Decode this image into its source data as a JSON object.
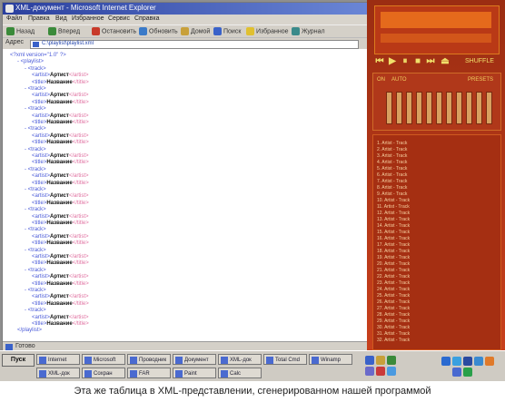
{
  "ie": {
    "title": "XML-документ - Microsoft Internet Explorer",
    "menu": [
      "Файл",
      "Правка",
      "Вид",
      "Избранное",
      "Сервис",
      "Справка"
    ],
    "toolbar": [
      "Назад",
      "Вперед",
      "Остановить",
      "Обновить",
      "Домой",
      "Поиск",
      "Избранное",
      "Журнал"
    ],
    "address_label": "Адрес",
    "address_value": "C:\\playlist\\playlist.xml",
    "status": "Готово"
  },
  "xml_lines": [
    {
      "indent": 0,
      "text": "<?xml version=\"1.0\" ?>",
      "kind": "tag"
    },
    {
      "indent": 1,
      "text": "- <playlist>",
      "kind": "tag"
    },
    {
      "indent": 2,
      "text": "- <track>",
      "kind": "tag"
    },
    {
      "indent": 3,
      "text": "<artist>",
      "kind": "tag",
      "value": "Артист",
      "end": "</artist>"
    },
    {
      "indent": 3,
      "text": "<title>",
      "kind": "tag",
      "value": "Название",
      "end": "</title>"
    },
    {
      "indent": 2,
      "text": "- <track>",
      "kind": "tag"
    },
    {
      "indent": 3,
      "text": "<artist>",
      "kind": "tag",
      "value": "Артист",
      "end": "</artist>"
    },
    {
      "indent": 3,
      "text": "<title>",
      "kind": "tag",
      "value": "Название",
      "end": "</title>"
    },
    {
      "indent": 2,
      "text": "- <track>",
      "kind": "tag"
    },
    {
      "indent": 3,
      "text": "<artist>",
      "kind": "tag",
      "value": "Артист",
      "end": "</artist>"
    },
    {
      "indent": 3,
      "text": "<title>",
      "kind": "tag",
      "value": "Название",
      "end": "</title>"
    },
    {
      "indent": 2,
      "text": "- <track>",
      "kind": "tag"
    },
    {
      "indent": 3,
      "text": "<artist>",
      "kind": "tag",
      "value": "Артист",
      "end": "</artist>"
    },
    {
      "indent": 3,
      "text": "<title>",
      "kind": "tag",
      "value": "Название",
      "end": "</title>"
    },
    {
      "indent": 2,
      "text": "- <track>",
      "kind": "tag"
    },
    {
      "indent": 3,
      "text": "<artist>",
      "kind": "tag",
      "value": "Артист",
      "end": "</artist>"
    },
    {
      "indent": 3,
      "text": "<title>",
      "kind": "tag",
      "value": "Название",
      "end": "</title>"
    },
    {
      "indent": 2,
      "text": "- <track>",
      "kind": "tag"
    },
    {
      "indent": 3,
      "text": "<artist>",
      "kind": "tag",
      "value": "Артист",
      "end": "</artist>"
    },
    {
      "indent": 3,
      "text": "<title>",
      "kind": "tag",
      "value": "Название",
      "end": "</title>"
    },
    {
      "indent": 2,
      "text": "- <track>",
      "kind": "tag"
    },
    {
      "indent": 3,
      "text": "<artist>",
      "kind": "tag",
      "value": "Артист",
      "end": "</artist>"
    },
    {
      "indent": 3,
      "text": "<title>",
      "kind": "tag",
      "value": "Название",
      "end": "</title>"
    },
    {
      "indent": 2,
      "text": "- <track>",
      "kind": "tag"
    },
    {
      "indent": 3,
      "text": "<artist>",
      "kind": "tag",
      "value": "Артист",
      "end": "</artist>"
    },
    {
      "indent": 3,
      "text": "<title>",
      "kind": "tag",
      "value": "Название",
      "end": "</title>"
    },
    {
      "indent": 2,
      "text": "- <track>",
      "kind": "tag"
    },
    {
      "indent": 3,
      "text": "<artist>",
      "kind": "tag",
      "value": "Артист",
      "end": "</artist>"
    },
    {
      "indent": 3,
      "text": "<title>",
      "kind": "tag",
      "value": "Название",
      "end": "</title>"
    },
    {
      "indent": 2,
      "text": "- <track>",
      "kind": "tag"
    },
    {
      "indent": 3,
      "text": "<artist>",
      "kind": "tag",
      "value": "Артист",
      "end": "</artist>"
    },
    {
      "indent": 3,
      "text": "<title>",
      "kind": "tag",
      "value": "Название",
      "end": "</title>"
    },
    {
      "indent": 2,
      "text": "- <track>",
      "kind": "tag"
    },
    {
      "indent": 3,
      "text": "<artist>",
      "kind": "tag",
      "value": "Артист",
      "end": "</artist>"
    },
    {
      "indent": 3,
      "text": "<title>",
      "kind": "tag",
      "value": "Название",
      "end": "</title>"
    },
    {
      "indent": 2,
      "text": "- <track>",
      "kind": "tag"
    },
    {
      "indent": 3,
      "text": "<artist>",
      "kind": "tag",
      "value": "Артист",
      "end": "</artist>"
    },
    {
      "indent": 3,
      "text": "<title>",
      "kind": "tag",
      "value": "Название",
      "end": "</title>"
    },
    {
      "indent": 2,
      "text": "- <track>",
      "kind": "tag"
    },
    {
      "indent": 3,
      "text": "<artist>",
      "kind": "tag",
      "value": "Артист",
      "end": "</artist>"
    },
    {
      "indent": 3,
      "text": "<title>",
      "kind": "tag",
      "value": "Название",
      "end": "</title>"
    },
    {
      "indent": 1,
      "text": "</playlist>",
      "kind": "tag"
    }
  ],
  "winamp": {
    "mode_label": "SHUFFLE",
    "eq_labels": [
      "ON",
      "AUTO",
      "PRESETS"
    ],
    "playlist": [
      "1. Artist - Track",
      "2. Artist - Track",
      "3. Artist - Track",
      "4. Artist - Track",
      "5. Artist - Track",
      "6. Artist - Track",
      "7. Artist - Track",
      "8. Artist - Track",
      "9. Artist - Track",
      "10. Artist - Track",
      "11. Artist - Track",
      "12. Artist - Track",
      "13. Artist - Track",
      "14. Artist - Track",
      "15. Artist - Track",
      "16. Artist - Track",
      "17. Artist - Track",
      "18. Artist - Track",
      "19. Artist - Track",
      "20. Artist - Track",
      "21. Artist - Track",
      "22. Artist - Track",
      "23. Artist - Track",
      "24. Artist - Track",
      "25. Artist - Track",
      "26. Artist - Track",
      "27. Artist - Track",
      "28. Artist - Track",
      "29. Artist - Track",
      "30. Artist - Track",
      "31. Artist - Track",
      "32. Artist - Track"
    ]
  },
  "taskbar": {
    "start": "Пуск",
    "tasks_row1": [
      "Internet",
      "Microsoft",
      "Проводник",
      "Документ",
      "XML-док",
      "Total Cmd",
      "Winamp"
    ],
    "tasks_row2": [
      "XML-док",
      "Сохран",
      "FAR",
      "Paint",
      "Calc"
    ]
  },
  "caption": "Эта же таблица в XML-представлении, сгенерированном нашей программой"
}
